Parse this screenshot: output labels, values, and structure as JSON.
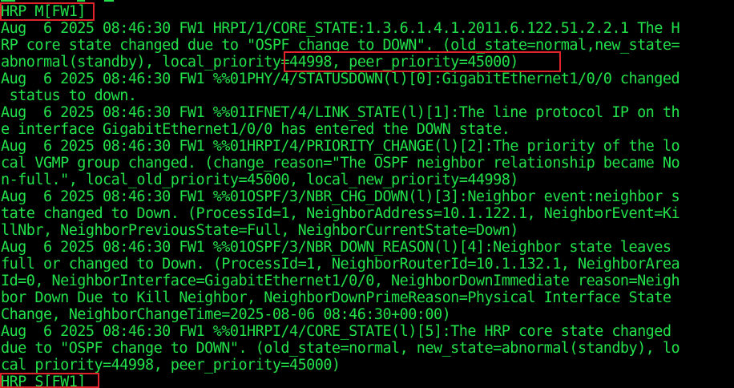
{
  "terminal": {
    "colors": {
      "background": "#000000",
      "text": "#22e04a",
      "highlight": "#e0232b"
    },
    "lines": [
      "HRP_M[FW1]",
      "Aug  6 2025 08:46:30 FW1 HRPI/1/CORE_STATE:1.3.6.1.4.1.2011.6.122.51.2.2.1 The H",
      "RP core state changed due to \"OSPF change to DOWN\". (old_state=normal,new_state=",
      "abnormal(standby), local_priority=44998, peer_priority=45000)",
      "Aug  6 2025 08:46:30 FW1 %%01PHY/4/STATUSDOWN(l)[0]:GigabitEthernet1/0/0 changed",
      " status to down.",
      "Aug  6 2025 08:46:30 FW1 %%01IFNET/4/LINK_STATE(l)[1]:The line protocol IP on th",
      "e interface GigabitEthernet1/0/0 has entered the DOWN state.",
      "Aug  6 2025 08:46:30 FW1 %%01HRPI/4/PRIORITY_CHANGE(l)[2]:The priority of the lo",
      "cal VGMP group changed. (change_reason=\"The OSPF neighbor relationship became No",
      "n-full.\", local_old_priority=45000, local_new_priority=44998)",
      "Aug  6 2025 08:46:30 FW1 %%01OSPF/3/NBR_CHG_DOWN(l)[3]:Neighbor event:neighbor s",
      "tate changed to Down. (ProcessId=1, NeighborAddress=10.1.122.1, NeighborEvent=Ki",
      "llNbr, NeighborPreviousState=Full, NeighborCurrentState=Down)",
      "Aug  6 2025 08:46:30 FW1 %%01OSPF/3/NBR_DOWN_REASON(l)[4]:Neighbor state leaves",
      "full or changed to Down. (ProcessId=1, NeighborRouterId=10.1.132.1, NeighborArea",
      "Id=0, NeighborInterface=GigabitEthernet1/0/0, NeighborDownImmediate reason=Neigh",
      "bor Down Due to Kill Neighbor, NeighborDownPrimeReason=Physical Interface State",
      "Change, NeighborChangeTime=2025-08-06 08:46:30+00:00)",
      "Aug  6 2025 08:46:30 FW1 %%01HRPI/4/CORE_STATE(l)[5]:The HRP core state changed",
      "due to \"OSPF change to DOWN\". (old_state=normal, new_state=abnormal(standby), lo",
      "cal_priority=44998, peer_priority=45000)",
      "HRP_S[FW1]"
    ]
  }
}
